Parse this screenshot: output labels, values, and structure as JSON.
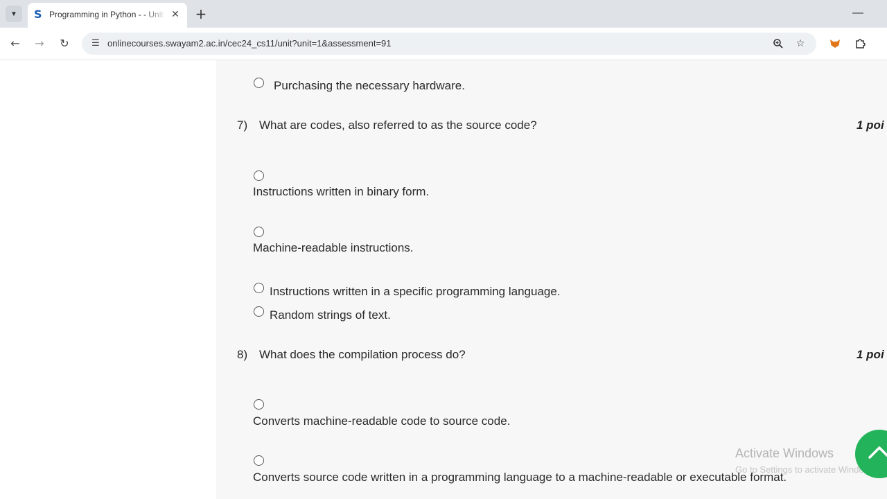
{
  "browser": {
    "tab_title": "Programming in Python - - Unit",
    "url": "onlinecourses.swayam2.ac.in/cec24_cs11/unit?unit=1&assessment=91",
    "favicon_letter": "S"
  },
  "quiz": {
    "prev_option": "Purchasing the necessary hardware.",
    "questions": [
      {
        "number": "7)",
        "text": "What are codes, also referred to as the source code?",
        "points": "1 poi",
        "options": [
          "Instructions written in binary form.",
          "Machine-readable instructions.",
          "Instructions written in a specific programming language.",
          "Random strings of text."
        ]
      },
      {
        "number": "8)",
        "text": "What does the compilation process do?",
        "points": "1 poi",
        "options": [
          "Converts machine-readable code to source code.",
          "Converts source code written in a programming language to a machine-readable or executable format."
        ]
      }
    ]
  },
  "watermark": {
    "title": "Activate Windows",
    "subtitle": "Go to Settings to activate Windows."
  },
  "colors": {
    "fab": "#23b35a",
    "content_bg": "#f7f7f7",
    "tabstrip_bg": "#dfe3e8"
  }
}
